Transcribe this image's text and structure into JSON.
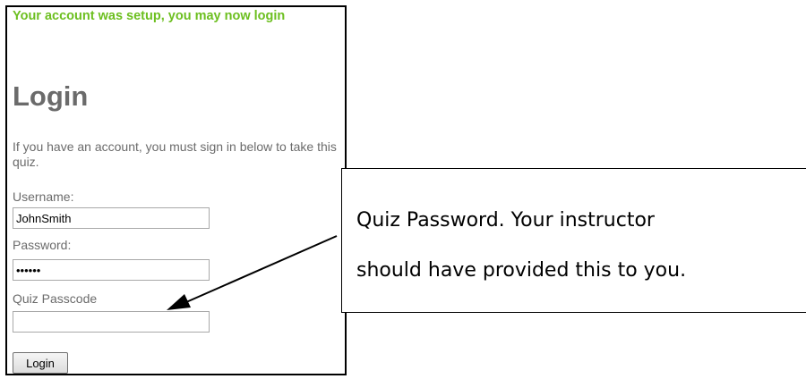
{
  "login_panel": {
    "success_message": "Your account was setup, you may now login",
    "heading": "Login",
    "intro": "If you have an account, you must sign in below to take this quiz.",
    "username": {
      "label": "Username:",
      "value": "JohnSmith"
    },
    "password": {
      "label": "Password:",
      "value": "••••••"
    },
    "quiz_passcode": {
      "label": "Quiz Passcode",
      "value": ""
    },
    "login_button_label": "Login"
  },
  "callout": {
    "line1": "Quiz Password. Your instructor",
    "line2": "should have provided this to you."
  },
  "colors": {
    "success_green": "#6cbf1f",
    "text_gray": "#6b6b6b"
  }
}
